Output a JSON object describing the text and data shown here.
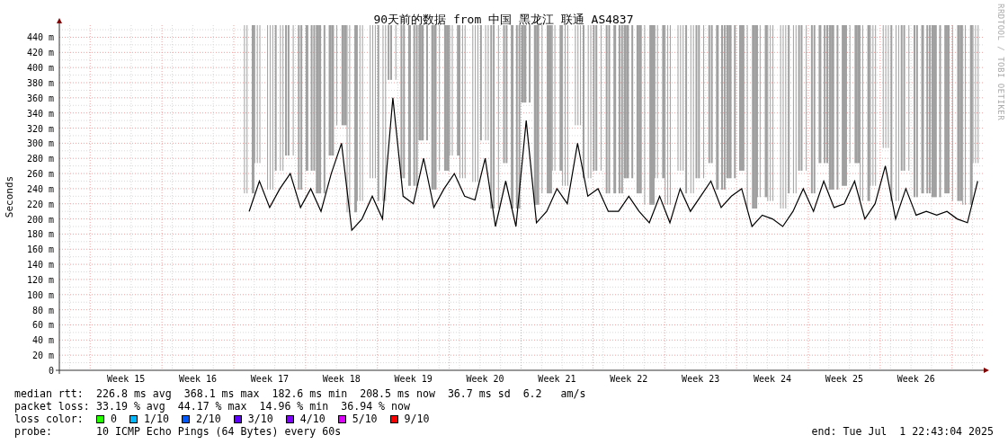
{
  "chart": {
    "watermark": "RRDTOOL / TOBI OETIKER",
    "chart_data": {
      "type": "line",
      "grid": true,
      "title": "90天前的数据 from 中国 黑龙江 联通 AS4837",
      "ylabel": "Seconds",
      "ylim": [
        0,
        456
      ],
      "categories": [
        null,
        null,
        null,
        null,
        null,
        null,
        "Week 15",
        null,
        null,
        null,
        null,
        null,
        null,
        "Week 16",
        null,
        null,
        null,
        null,
        null,
        null,
        "Week 17",
        null,
        null,
        null,
        null,
        null,
        null,
        "Week 18",
        null,
        null,
        null,
        null,
        null,
        null,
        "Week 19",
        null,
        null,
        null,
        null,
        null,
        null,
        "Week 20",
        null,
        null,
        null,
        null,
        null,
        null,
        "Week 21",
        null,
        null,
        null,
        null,
        null,
        null,
        "Week 22",
        null,
        null,
        null,
        null,
        null,
        null,
        "Week 23",
        null,
        null,
        null,
        null,
        null,
        null,
        "Week 24",
        null,
        null,
        null,
        null,
        null,
        null,
        "Week 25",
        null,
        null,
        null,
        null,
        null,
        null,
        "Week 26",
        null,
        null,
        null,
        null,
        null,
        null
      ],
      "yticks": [
        {
          "value": 0,
          "label": "0"
        },
        {
          "value": 20,
          "label": "20 m"
        },
        {
          "value": 40,
          "label": "40 m"
        },
        {
          "value": 60,
          "label": "60 m"
        },
        {
          "value": 80,
          "label": "80 m"
        },
        {
          "value": 100,
          "label": "100 m"
        },
        {
          "value": 120,
          "label": "120 m"
        },
        {
          "value": 140,
          "label": "140 m"
        },
        {
          "value": 160,
          "label": "160 m"
        },
        {
          "value": 180,
          "label": "180 m"
        },
        {
          "value": 200,
          "label": "200 m"
        },
        {
          "value": 220,
          "label": "220 m"
        },
        {
          "value": 240,
          "label": "240 m"
        },
        {
          "value": 260,
          "label": "260 m"
        },
        {
          "value": 280,
          "label": "280 m"
        },
        {
          "value": 300,
          "label": "300 m"
        },
        {
          "value": 320,
          "label": "320 m"
        },
        {
          "value": 340,
          "label": "340 m"
        },
        {
          "value": 360,
          "label": "360 m"
        },
        {
          "value": 380,
          "label": "380 m"
        },
        {
          "value": 400,
          "label": "400 m"
        },
        {
          "value": 420,
          "label": "420 m"
        },
        {
          "value": 440,
          "label": "440 m"
        }
      ],
      "series": [
        {
          "name": "median rtt:",
          "color": "#000000",
          "values": [
            null,
            null,
            null,
            null,
            null,
            null,
            null,
            null,
            null,
            null,
            null,
            null,
            null,
            null,
            null,
            null,
            null,
            null,
            210,
            250,
            215,
            240,
            260,
            215,
            240,
            210,
            260,
            300,
            185,
            200,
            230,
            200,
            360,
            230,
            220,
            280,
            215,
            240,
            260,
            230,
            225,
            280,
            190,
            250,
            190,
            330,
            195,
            210,
            240,
            220,
            300,
            230,
            240,
            210,
            210,
            230,
            210,
            195,
            230,
            195,
            240,
            210,
            230,
            250,
            215,
            230,
            240,
            190,
            205,
            200,
            190,
            210,
            240,
            210,
            250,
            215,
            220,
            250,
            200,
            220,
            270,
            200,
            240,
            205,
            210,
            205,
            210,
            200,
            195,
            250
          ]
        }
      ]
    }
  },
  "legend": [
    {
      "kind": "series",
      "text": "226.8 ms avg  368.1 ms max  182.6 ms min  208.5 ms now  36.7 ms sd  6.2   am/s"
    },
    {
      "kind": "text",
      "label": "packet loss:",
      "text": "33.19 % avg  44.17 % max  14.96 % min  36.94 % now"
    },
    {
      "kind": "swatches",
      "label": "loss color:",
      "items": [
        {
          "label": "0",
          "color": "#26ff00"
        },
        {
          "label": "1/10",
          "color": "#00b8ff"
        },
        {
          "label": "2/10",
          "color": "#0059ff"
        },
        {
          "label": "3/10",
          "color": "#5e00ff"
        },
        {
          "label": "4/10",
          "color": "#7e00ff"
        },
        {
          "label": "5/10",
          "color": "#dd00ff"
        },
        {
          "label": "9/10",
          "color": "#ff0000"
        }
      ]
    },
    {
      "kind": "text",
      "label": "probe:",
      "text": "10 ICMP Echo Pings (64 Bytes) every 60s",
      "end": "end: Tue Jul  1 22:43:04 2025"
    }
  ]
}
